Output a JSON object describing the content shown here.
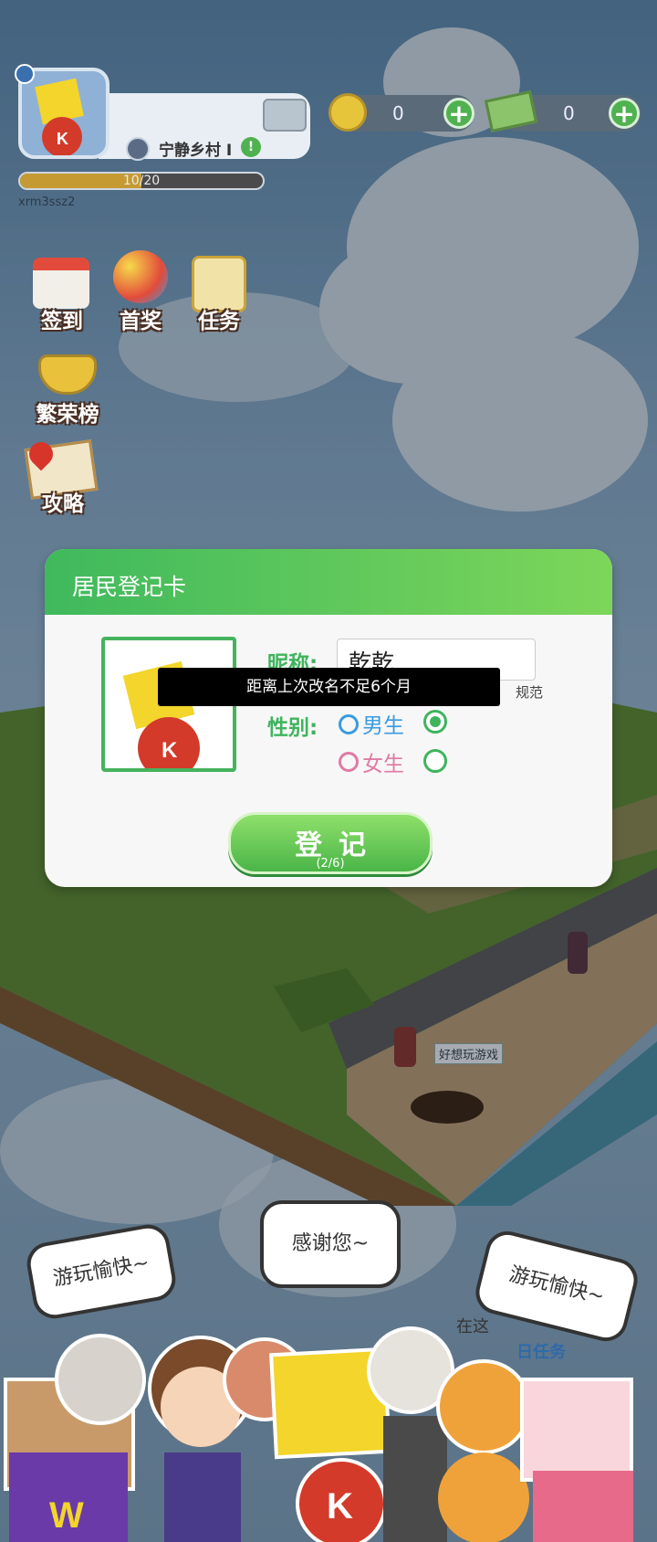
{
  "hud": {
    "town_name": "宁静乡村",
    "town_suffix": "I",
    "xp_text": "10/20",
    "xp_progress": 0.5,
    "username": "xrm3ssz2",
    "coins": "0",
    "cash": "0"
  },
  "side_menu": [
    {
      "label": "签到",
      "icon": "calendar-heart-icon"
    },
    {
      "label": "首奖",
      "icon": "balloons-gift-icon"
    },
    {
      "label": "任务",
      "icon": "clipboard-icon"
    },
    {
      "label": "繁荣榜",
      "icon": "trophy-icon"
    },
    {
      "label": "攻略",
      "icon": "map-pin-icon"
    }
  ],
  "dialog": {
    "title": "居民登记卡",
    "nickname_label": "昵称:",
    "nickname_value": "乾乾",
    "gender_label": "性别:",
    "gender_male": "男生",
    "gender_female": "女生",
    "selected_gender": "male",
    "hint_tail": "规范",
    "toast": "距离上次改名不足6个月",
    "register_label": "登记",
    "register_count": "(2/6)"
  },
  "scene": {
    "npc_tag": "好想玩游戏",
    "task_text_1": "在这",
    "task_text_2": "日任务"
  },
  "bubbles": {
    "left": "游玩愉快~",
    "center": "感谢您~",
    "right": "游玩愉快~"
  },
  "colors": {
    "accent_green": "#3fb45d",
    "male_blue": "#3a9be0",
    "female_pink": "#e07aa4"
  }
}
